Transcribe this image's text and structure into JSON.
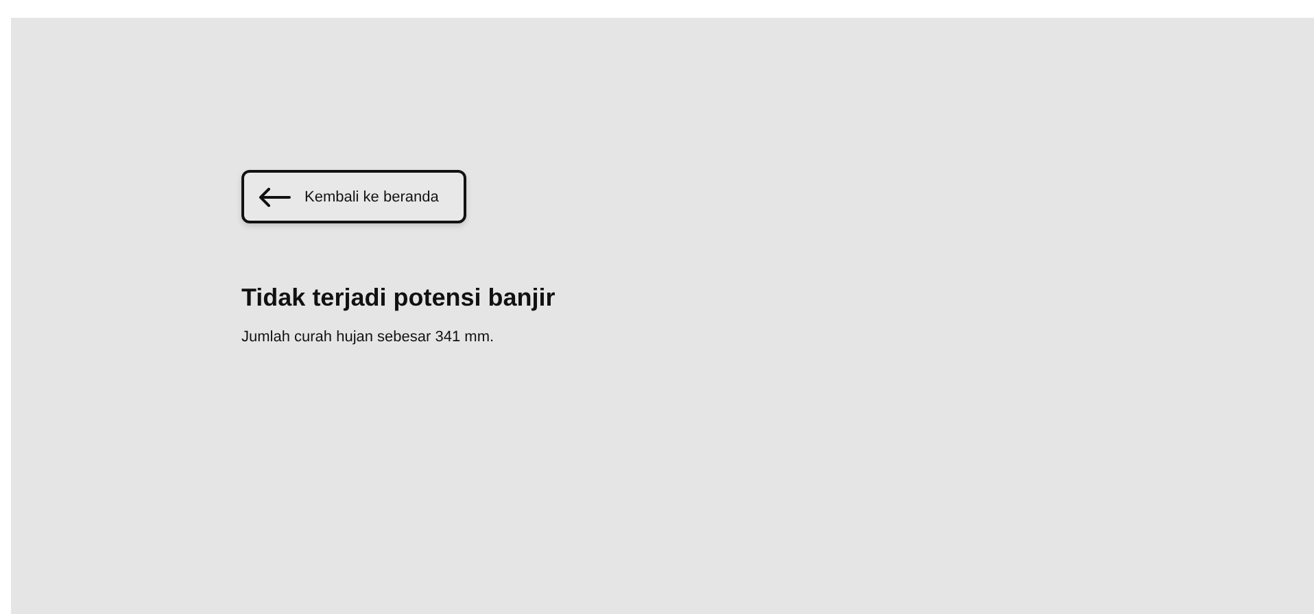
{
  "back_button": {
    "label": "Kembali ke beranda"
  },
  "result": {
    "title": "Tidak terjadi potensi banjir",
    "description": "Jumlah curah hujan sebesar 341 mm."
  }
}
